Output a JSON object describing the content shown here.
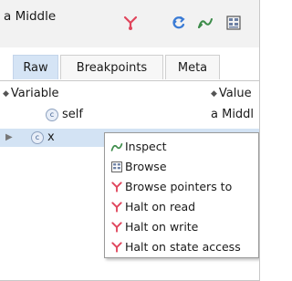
{
  "window": {
    "title": "a Middle"
  },
  "toolbar": {
    "icons": [
      "pointer-fork-icon",
      "refresh-icon",
      "inspect-icon",
      "browse-icon"
    ]
  },
  "tabs": [
    {
      "label": "Raw",
      "active": true
    },
    {
      "label": "Breakpoints",
      "active": false
    },
    {
      "label": "Meta",
      "active": false
    }
  ],
  "table": {
    "headers": {
      "variable": "Variable",
      "value": "Value"
    },
    "rows": [
      {
        "badge": "c",
        "name": "self",
        "value": "a Middl",
        "expandable": false,
        "selected": false
      },
      {
        "badge": "c",
        "name": "x",
        "value": "",
        "expandable": true,
        "selected": true
      }
    ]
  },
  "context_menu": {
    "items": [
      {
        "label": "Inspect",
        "icon": "inspect-icon"
      },
      {
        "label": "Browse",
        "icon": "browse-icon"
      },
      {
        "label": "Browse pointers to",
        "icon": "pointer-fork-icon"
      },
      {
        "label": "Halt on read",
        "icon": "pointer-fork-icon"
      },
      {
        "label": "Halt on write",
        "icon": "pointer-fork-icon"
      },
      {
        "label": "Halt on state access",
        "icon": "pointer-fork-icon"
      }
    ]
  },
  "colors": {
    "selected_row": "#d3e3f4",
    "active_tab": "#d5e4f5",
    "fork_icon": "#e0455c",
    "refresh_icon": "#3a7bd5",
    "inspect_icon": "#3d8c4a"
  }
}
